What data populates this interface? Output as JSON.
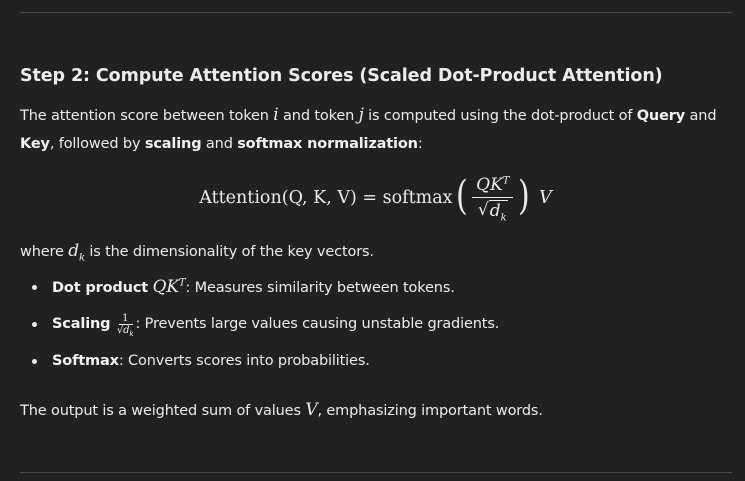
{
  "heading": "Step 2: Compute Attention Scores (Scaled Dot-Product Attention)",
  "intro": {
    "t1": "The attention score between token ",
    "var_i": "i",
    "t2": " and token ",
    "var_j": "j",
    "t3": " is computed using the dot-product of ",
    "query": "Query",
    "t4": " and ",
    "key": "Key",
    "t5": ", followed by ",
    "scaling": "scaling",
    "t6": " and ",
    "softmax_norm": "softmax normalization",
    "t7": ":"
  },
  "equation": {
    "lhs": "Attention(Q, K, V) = softmax",
    "num": "QK",
    "num_sup": "T",
    "den_radicand": "d",
    "den_sub": "k",
    "tail": "V"
  },
  "where": {
    "t1": "where ",
    "var": "d",
    "sub": "k",
    "t2": " is the dimensionality of the key vectors."
  },
  "bullets": [
    {
      "bold": "Dot product",
      "math": "QK",
      "sup": "T",
      "text": ": Measures similarity between tokens."
    },
    {
      "bold": "Scaling",
      "frac_num": "1",
      "frac_den": "d",
      "frac_sub": "k",
      "text": ": Prevents large values causing unstable gradients."
    },
    {
      "bold": "Softmax",
      "text": ": Converts scores into probabilities."
    }
  ],
  "output": {
    "t1": "The output is a weighted sum of values ",
    "var": "V",
    "t2": ", emphasizing important words."
  }
}
